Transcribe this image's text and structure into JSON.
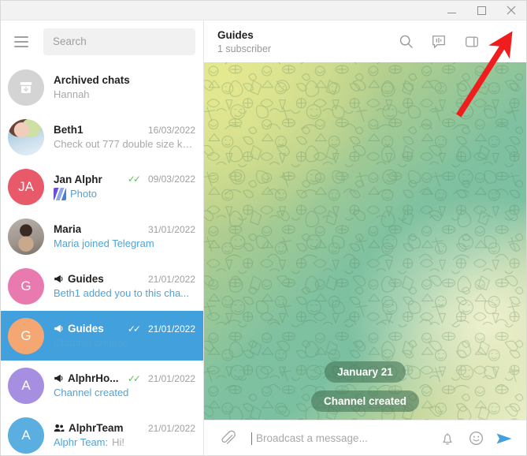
{
  "window": {
    "controls": {
      "minimize": "—",
      "maximize": "□",
      "close": "✕"
    }
  },
  "sidebar": {
    "menu_icon": "hamburger-icon",
    "search": {
      "placeholder": "Search",
      "value": ""
    },
    "chats": [
      {
        "name": "Archived chats",
        "preview": "Hannah",
        "date": "",
        "avatar_type": "archive",
        "avatar_letters": "",
        "avatar_color": "#d4d4d4",
        "preview_style": "muted",
        "icon": "",
        "ticks": false,
        "selected": false
      },
      {
        "name": "Beth1",
        "preview": "Check out 777 double size ko...",
        "date": "16/03/2022",
        "avatar_type": "photo-beth",
        "avatar_letters": "",
        "avatar_color": "",
        "preview_style": "muted",
        "icon": "",
        "ticks": false,
        "selected": false
      },
      {
        "name": "Jan Alphr",
        "preview": "Photo",
        "date": "09/03/2022",
        "avatar_type": "letters",
        "avatar_letters": "JA",
        "avatar_color": "#e8596a",
        "preview_style": "link",
        "icon": "",
        "thumbnail": "photo-thumbnail",
        "ticks": true,
        "selected": false
      },
      {
        "name": "Maria",
        "preview": "Maria joined Telegram",
        "date": "31/01/2022",
        "avatar_type": "photo-maria",
        "avatar_letters": "",
        "avatar_color": "",
        "preview_style": "link",
        "icon": "",
        "ticks": false,
        "selected": false
      },
      {
        "name": "Guides",
        "preview": "Beth1 added you to this cha...",
        "date": "21/01/2022",
        "avatar_type": "letters",
        "avatar_letters": "G",
        "avatar_color": "#e87ab0",
        "preview_style": "link",
        "icon": "megaphone-icon",
        "ticks": false,
        "selected": false
      },
      {
        "name": "Guides",
        "preview": "Channel created",
        "date": "21/01/2022",
        "avatar_type": "letters",
        "avatar_letters": "G",
        "avatar_color": "#f5a773",
        "preview_style": "link",
        "icon": "megaphone-icon",
        "ticks": true,
        "selected": true
      },
      {
        "name": "AlphrHo...",
        "preview": "Channel created",
        "date": "21/01/2022",
        "avatar_type": "letters",
        "avatar_letters": "A",
        "avatar_color": "#a68ee0",
        "preview_style": "link",
        "icon": "megaphone-icon",
        "ticks": true,
        "selected": false
      },
      {
        "name": "AlphrTeam",
        "preview_sender": "Alphr Team:",
        "preview": "Hi!",
        "date": "21/01/2022",
        "avatar_type": "letters",
        "avatar_letters": "A",
        "avatar_color": "#5aaee0",
        "preview_style": "muted",
        "icon": "group-icon",
        "ticks": false,
        "selected": false
      }
    ]
  },
  "chat_header": {
    "title": "Guides",
    "subtitle": "1 subscriber",
    "actions": [
      {
        "name": "search-icon",
        "label": "Search"
      },
      {
        "name": "discussion-icon",
        "label": "Discussion"
      },
      {
        "name": "panel-toggle-icon",
        "label": "Info panel"
      },
      {
        "name": "more-menu-icon",
        "label": "More"
      }
    ]
  },
  "messages": {
    "date_pill": "January 21",
    "service_message": "Channel created"
  },
  "composer": {
    "attach_icon": "paperclip-icon",
    "placeholder": "Broadcast a message...",
    "value": "",
    "mute_icon": "bell-icon",
    "emoji_icon": "smiley-icon",
    "send_icon": "send-icon"
  },
  "annotation": {
    "arrow_color": "#ef1d1d",
    "points_to": "more-menu-icon"
  },
  "colors": {
    "accent": "#42a0dd",
    "selection": "#42a0dd",
    "tick_green": "#5dc45d",
    "link": "#4ea4d8"
  }
}
